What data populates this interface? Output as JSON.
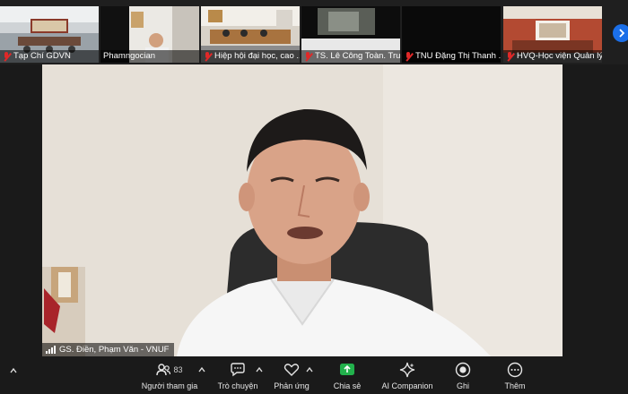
{
  "participants_strip": [
    {
      "name": "Tạp Chí GDVN",
      "muted": true
    },
    {
      "name": "Phamngocian",
      "muted": false
    },
    {
      "name": "Hiệp hội đại học, cao ...",
      "muted": true
    },
    {
      "name": "TS. Lê Công Toàn. Trườ...",
      "muted": true
    },
    {
      "name": "TNU Đặng Thị Thanh ...",
      "muted": true
    },
    {
      "name": "HVQ-Học viện Quản lý...",
      "muted": true
    }
  ],
  "active_speaker": {
    "name": "GS. Điền, Phạm Văn - VNUF"
  },
  "toolbar": {
    "participants_label": "Người tham gia",
    "participants_count": "83",
    "chat_label": "Trò chuyện",
    "reactions_label": "Phản ứng",
    "share_label": "Chia sẻ",
    "ai_label": "AI Companion",
    "record_label": "Ghi",
    "more_label": "Thêm"
  },
  "colors": {
    "accent": "#1b6fe8",
    "share_green": "#22b14c",
    "muted_red": "#e02828"
  }
}
